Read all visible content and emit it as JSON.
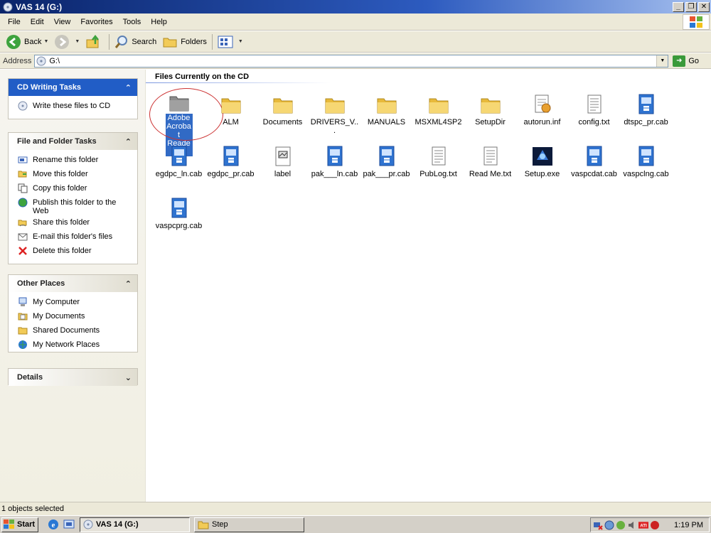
{
  "window": {
    "title": "VAS 14 (G:)"
  },
  "menu": [
    "File",
    "Edit",
    "View",
    "Favorites",
    "Tools",
    "Help"
  ],
  "toolbar": {
    "back": "Back",
    "search": "Search",
    "folders": "Folders"
  },
  "address": {
    "label": "Address",
    "value": "G:\\",
    "go": "Go"
  },
  "cd_tasks": {
    "title": "CD Writing Tasks",
    "items": [
      "Write these files to CD"
    ]
  },
  "folder_tasks": {
    "title": "File and Folder Tasks",
    "items": [
      "Rename this folder",
      "Move this folder",
      "Copy this folder",
      "Publish this folder to the Web",
      "Share this folder",
      "E-mail this folder's files",
      "Delete this folder"
    ]
  },
  "other_places": {
    "title": "Other Places",
    "items": [
      "My Computer",
      "My Documents",
      "Shared Documents",
      "My Network Places"
    ]
  },
  "details": {
    "title": "Details"
  },
  "files": {
    "section_title": "Files Currently on the CD",
    "items": [
      {
        "name": "Adobe Acrobat Reader",
        "icon": "folder-gray",
        "selected": true
      },
      {
        "name": "ALM",
        "icon": "folder"
      },
      {
        "name": "Documents",
        "icon": "folder"
      },
      {
        "name": "DRIVERS_V...",
        "icon": "folder"
      },
      {
        "name": "MANUALS",
        "icon": "folder"
      },
      {
        "name": "MSXML4SP2",
        "icon": "folder"
      },
      {
        "name": "SetupDir",
        "icon": "folder"
      },
      {
        "name": "autorun.inf",
        "icon": "inf"
      },
      {
        "name": "config.txt",
        "icon": "txt"
      },
      {
        "name": "dtspc_pr.cab",
        "icon": "cab"
      },
      {
        "name": "egdpc_ln.cab",
        "icon": "cab"
      },
      {
        "name": "egdpc_pr.cab",
        "icon": "cab"
      },
      {
        "name": "label",
        "icon": "image"
      },
      {
        "name": "pak___ln.cab",
        "icon": "cab"
      },
      {
        "name": "pak___pr.cab",
        "icon": "cab"
      },
      {
        "name": "PubLog.txt",
        "icon": "txt"
      },
      {
        "name": "Read Me.txt",
        "icon": "txt"
      },
      {
        "name": "Setup.exe",
        "icon": "exe"
      },
      {
        "name": "vaspcdat.cab",
        "icon": "cab"
      },
      {
        "name": "vaspclng.cab",
        "icon": "cab"
      },
      {
        "name": "vaspcprg.cab",
        "icon": "cab"
      }
    ]
  },
  "status": {
    "text": "1 objects selected"
  },
  "taskbar": {
    "start": "Start",
    "tasks": [
      "VAS 14 (G:)",
      "Step"
    ],
    "clock": "1:19 PM"
  },
  "colors": {
    "titlebar": "#0a246a",
    "selection": "#316ac5",
    "folder": "#f2cb57"
  }
}
